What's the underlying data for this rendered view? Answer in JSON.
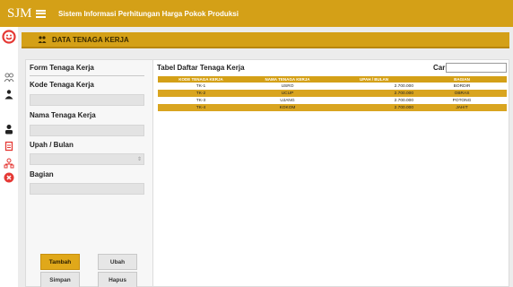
{
  "app": {
    "brand": "SJM",
    "title": "Sistem Informasi Perhitungan Harga Pokok Produksi"
  },
  "icons": {
    "menu": "hamburger-icon",
    "logo": "logo-icon",
    "page_header": "team-icon",
    "sidebar": [
      "people-icon",
      "person-tie-icon",
      "user-icon",
      "document-icon",
      "network-icon",
      "close-circle-icon"
    ]
  },
  "colors": {
    "accent": "#d4a017",
    "content_bg": "#ececec",
    "danger": "#e53935"
  },
  "page": {
    "header_title": "DATA TENAGA KERJA"
  },
  "form": {
    "title": "Form Tenaga Kerja",
    "kode_label": "Kode Tenaga Kerja",
    "kode_value": "",
    "nama_label": "Nama Tenaga Kerja",
    "nama_value": "",
    "upah_label": "Upah / Bulan",
    "upah_value": "",
    "bagian_label": "Bagian",
    "bagian_value": "",
    "buttons": {
      "tambah": "Tambah",
      "ubah": "Ubah",
      "simpan": "Simpan",
      "hapus": "Hapus"
    }
  },
  "table": {
    "title": "Tabel Daftar Tenaga Kerja",
    "search_label": "Cari :",
    "search_value": "",
    "columns": [
      "KODE TENAGA KERJA",
      "NAMA TENAGA KERJA",
      "UPAH / BULAN",
      "BAGIAN"
    ],
    "rows": [
      {
        "kode": "TK-1",
        "nama": "USRO",
        "upah": "2.700.000",
        "bagian": "BORDIR"
      },
      {
        "kode": "TK-2",
        "nama": "UCUP",
        "upah": "2.700.000",
        "bagian": "OBRAS"
      },
      {
        "kode": "TK-3",
        "nama": "UJANG",
        "upah": "2.700.000",
        "bagian": "POTONG"
      },
      {
        "kode": "TK-4",
        "nama": "KOKOM",
        "upah": "2.700.000",
        "bagian": "JAHIT"
      }
    ]
  }
}
